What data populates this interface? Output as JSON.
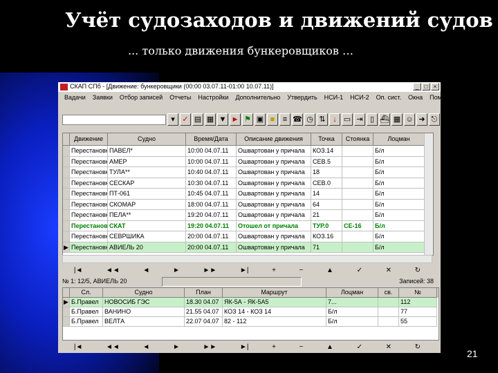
{
  "slide": {
    "title": "Учёт судозаходов и движений судов",
    "subtitle": "... только движения бункеровщиков …",
    "page_number": "21"
  },
  "window": {
    "title": "СКАП СПб - [Движение: бункеровщики (00:00 03.07.11-01:00 10.07.11)]",
    "buttons": [
      "_",
      "□",
      "×"
    ],
    "menu": [
      "Вадачи",
      "Заявки",
      "Отбор записей",
      "Отчеты",
      "Настройки",
      "Дополнительно",
      "Утвердить",
      "НСИ-1",
      "НСИ-2",
      "Оп. сист.",
      "Окна",
      "Помощь"
    ]
  },
  "toolbar": {
    "icons": [
      "check-icon",
      "document-icon",
      "print-icon",
      "filter-icon",
      "arrow-right-icon",
      "calendar-icon",
      "folder-icon",
      "phone-icon",
      "clock-icon",
      "sort-icon",
      "down-red-icon",
      "export-icon",
      "import-icon",
      "door-icon",
      "ship-icon",
      "table-icon",
      "person-icon",
      "arrow-icon",
      "exit-icon"
    ]
  },
  "grid_movements": {
    "columns": [
      "",
      "Движение",
      "Судно",
      "Время/Дата",
      "Описание движения",
      "Точка",
      "Стоянка",
      "Лоцман"
    ],
    "rows": [
      {
        "ind": "",
        "c": [
          "Перестановка",
          "ПАВЕЛ*",
          "10:00 04.07.11",
          "Ошвартован у причала",
          "КОЗ.14",
          "",
          "Б/л"
        ],
        "style": ""
      },
      {
        "ind": "",
        "c": [
          "Перестановка",
          "АМЕР",
          "10:00 04.07.11",
          "Ошвартован у причала",
          "СЕВ.5",
          "",
          "Б/л"
        ],
        "style": ""
      },
      {
        "ind": "",
        "c": [
          "Перестановка",
          "ТУЛА**",
          "10:40 04.07.11",
          "Ошвартован у причала",
          "18",
          "",
          "Б/л"
        ],
        "style": ""
      },
      {
        "ind": "",
        "c": [
          "Перестановка",
          "СЕСКАР",
          "10:30 04.07.11",
          "Ошвартован у причала",
          "СЕВ.0",
          "",
          "Б/л"
        ],
        "style": ""
      },
      {
        "ind": "",
        "c": [
          "Перестановка",
          "ПТ-061",
          "10:45 04.07.11",
          "Ошвартован у причала",
          "14",
          "",
          "Б/л"
        ],
        "style": ""
      },
      {
        "ind": "",
        "c": [
          "Перестановка",
          "СКОМАР",
          "18:00 04.07.11",
          "Ошвартован у причала",
          "64",
          "",
          "Б/л"
        ],
        "style": ""
      },
      {
        "ind": "",
        "c": [
          "Перестановка",
          "ПЕЛА**",
          "19:20 04.07.11",
          "Ошвартован у причала",
          "21",
          "",
          "Б/л"
        ],
        "style": ""
      },
      {
        "ind": "",
        "c": [
          "Перестановка",
          "СКАТ",
          "19:20 04.07.11",
          "Отошел от причала",
          "ТУР.0",
          "СЕ-16",
          "Б/л"
        ],
        "style": "bold"
      },
      {
        "ind": "",
        "c": [
          "Перестановка",
          "СЕВРШИКА",
          "20:00 04.07.11",
          "Ошвартован у причала",
          "КОЗ.16",
          "",
          "Б/л"
        ],
        "style": ""
      },
      {
        "ind": "▶",
        "c": [
          "Перестановка",
          "АВИЕЛЬ 20",
          "20:00 04.07.11",
          "Ошвартован у причала",
          "71",
          "",
          "Б/л"
        ],
        "style": "green"
      }
    ]
  },
  "nav_labels": [
    "|◄",
    "◄◄",
    "◄",
    "►",
    "►►",
    "►|",
    "+",
    "−",
    "▲",
    "✓",
    "✕",
    "↻"
  ],
  "status": {
    "left": "№ 1: 12/5, АВИЕЛЬ 20",
    "right": "Записей: 38"
  },
  "grid_vessels": {
    "columns": [
      "",
      "Сл.",
      "Судно",
      "План",
      "Маршрут",
      "Лоцман",
      "св.",
      "№"
    ],
    "rows": [
      {
        "ind": "▶",
        "c": [
          "Б.Правел",
          "НОВОСИБ ГЭС",
          "18.30 04.07",
          "ЯК-5А - ЯК-5А5",
          "7...",
          "",
          "112"
        ],
        "style": "green"
      },
      {
        "ind": "",
        "c": [
          "Б.Правел",
          "ВАНИНО",
          "21.55 04.07",
          "КОЗ 14 - КОЗ 14",
          "Б/л",
          "",
          "77"
        ],
        "style": ""
      },
      {
        "ind": "",
        "c": [
          "Б.Правел",
          "ВЕЛТА",
          "22.07 04.07",
          "82 - 112",
          "Б/л",
          "",
          "55"
        ],
        "style": ""
      }
    ]
  }
}
